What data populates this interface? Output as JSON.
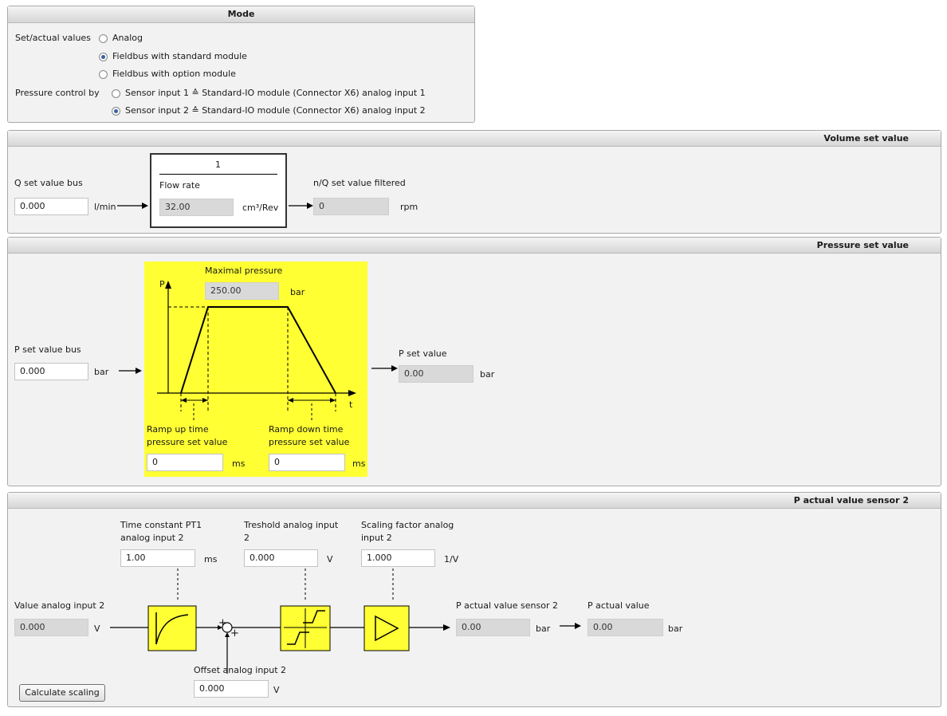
{
  "mode": {
    "title": "Mode",
    "set_actual_label": "Set/actual values",
    "options": [
      "Analog",
      "Fieldbus with standard module",
      "Fieldbus with option module"
    ],
    "pressure_control_label": "Pressure control by",
    "pressure_options": [
      "Sensor input 1 ≙ Standard-IO module (Connector X6) analog input 1",
      "Sensor input 2 ≙ Standard-IO module (Connector X6) analog input 2"
    ]
  },
  "volume": {
    "title": "Volume set value",
    "q_label": "Q set value bus",
    "q_value": "0.000",
    "q_unit": "l/min",
    "numerator": "1",
    "flow_label": "Flow rate",
    "flow_value": "32.00",
    "flow_unit": "cm³/Rev",
    "nq_label": "n/Q set value filtered",
    "nq_value": "0",
    "nq_unit": "rpm"
  },
  "pressure": {
    "title": "Pressure set value",
    "p_bus_label": "P set value bus",
    "p_bus_value": "0.000",
    "p_bus_unit": "bar",
    "max_label": "Maximal pressure",
    "max_value": "250.00",
    "max_unit": "bar",
    "axis_p": "P",
    "axis_t": "t",
    "ramp_up_label_1": "Ramp up time",
    "ramp_up_label_2": "pressure set value",
    "ramp_up_value": "0",
    "ramp_up_unit": "ms",
    "ramp_down_label_1": "Ramp down time",
    "ramp_down_label_2": "pressure set value",
    "ramp_down_value": "0",
    "ramp_down_unit": "ms",
    "p_set_label": "P set value",
    "p_set_value": "0.00",
    "p_set_unit": "bar"
  },
  "sensor": {
    "title": "P actual value sensor 2",
    "pt1_label_1": "Time constant PT1",
    "pt1_label_2": "analog input 2",
    "pt1_value": "1.00",
    "pt1_unit": "ms",
    "thr_label_1": "Treshold analog input",
    "thr_label_2": "2",
    "thr_value": "0.000",
    "thr_unit": "V",
    "scale_label_1": "Scaling factor analog",
    "scale_label_2": "input 2",
    "scale_value": "1.000",
    "scale_unit": "1/V",
    "val_label": "Value analog input 2",
    "val_value": "0.000",
    "val_unit": "V",
    "plus_top": "+",
    "plus_bottom": "+",
    "offset_label": "Offset analog input 2",
    "offset_value": "0.000",
    "offset_unit": "V",
    "sensor_out_label": "P actual value sensor 2",
    "sensor_out_value": "0.00",
    "sensor_out_unit": "bar",
    "actual_label": "P actual value",
    "actual_value": "0.00",
    "actual_unit": "bar",
    "calc_button": "Calculate scaling"
  }
}
